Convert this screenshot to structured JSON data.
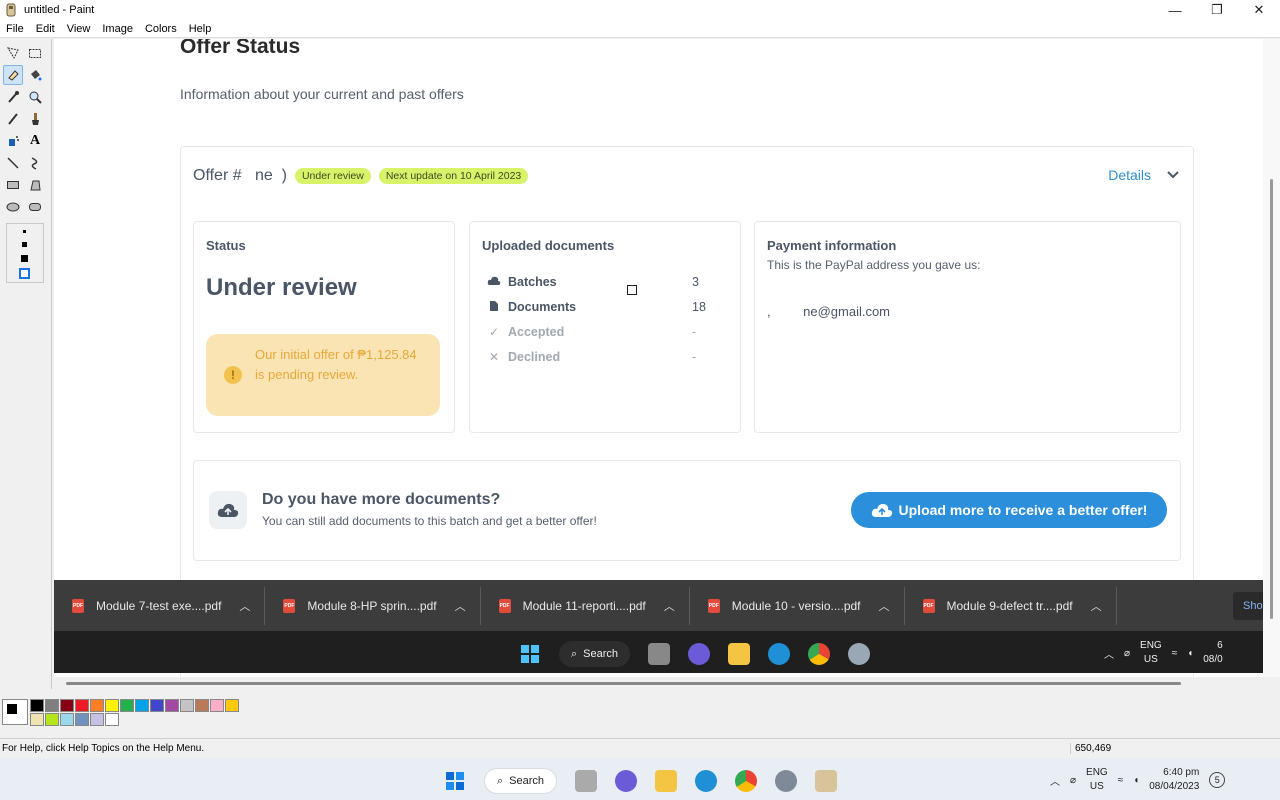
{
  "window": {
    "title": "untitled - Paint",
    "minimize": "—",
    "maximize": "❐",
    "close": "✕"
  },
  "menu": [
    "File",
    "Edit",
    "View",
    "Image",
    "Colors",
    "Help"
  ],
  "page": {
    "title": "Offer Status",
    "subtitle": "Information about your current and past offers",
    "offer": {
      "number": "Offer #​ ‌ ‌ ne‌ ‌ )",
      "badge_status": "Under review",
      "badge_update": "Next update on 10 April 2023",
      "details_label": "Details"
    },
    "status_panel": {
      "title": "Status",
      "value": "Under review",
      "notice": "Our initial offer of ₱1,125.84 is pending review."
    },
    "documents_panel": {
      "title": "Uploaded documents",
      "rows": [
        {
          "label": "Batches",
          "value": "3",
          "icon": "cloud-icon"
        },
        {
          "label": "Documents",
          "value": "18",
          "icon": "file-icon"
        },
        {
          "label": "Accepted",
          "value": "-",
          "icon": "check-icon"
        },
        {
          "label": "Declined",
          "value": "-",
          "icon": "x-icon"
        }
      ]
    },
    "payment_panel": {
      "title": "Payment information",
      "subtitle": "This is the PayPal address you gave us:",
      "email": ",                   ‌ ‌ ‌ ‌ ‌ ‌ ‌ ‌ ‌ne@gmail.com"
    },
    "more_docs": {
      "title": "Do you have more documents?",
      "subtitle": "You can still add documents to this batch and get a better offer!",
      "button": "Upload more to receive a better offer!"
    }
  },
  "downloads": [
    "Module 7-test exe....pdf",
    "Module 8-HP sprin....pdf",
    "Module 11-reporti....pdf",
    "Module 10 - versio....pdf",
    "Module 9-defect tr....pdf"
  ],
  "downloads_show": "Sho",
  "inner_taskbar": {
    "search": "Search",
    "lang": "ENG",
    "region": "US",
    "time": "6",
    "date": "08/0"
  },
  "status_bar": {
    "help": "For Help, click Help Topics on the Help Menu.",
    "coords": "650,469"
  },
  "taskbar": {
    "search": "Search",
    "lang": "ENG",
    "region": "US",
    "time": "6:40 pm",
    "date": "08/04/2023"
  },
  "colors": {
    "accent": "#2b8fdc",
    "badge": "#d8f26a",
    "notice_bg": "#fbe4b4",
    "notice_text": "#e7a83a"
  },
  "palette": [
    "#000000",
    "#7f7f7f",
    "#880015",
    "#ed1c24",
    "#ff7f27",
    "#fff200",
    "#22b14c",
    "#00a2e8",
    "#3f48cc",
    "#a349a4",
    "#c3c3c3",
    "#b97a57",
    "#ffaec9",
    "#ffc90e",
    "#efe4b0",
    "#b5e61d",
    "#99d9ea",
    "#7092be",
    "#c8bfe7",
    "#ffffff"
  ]
}
